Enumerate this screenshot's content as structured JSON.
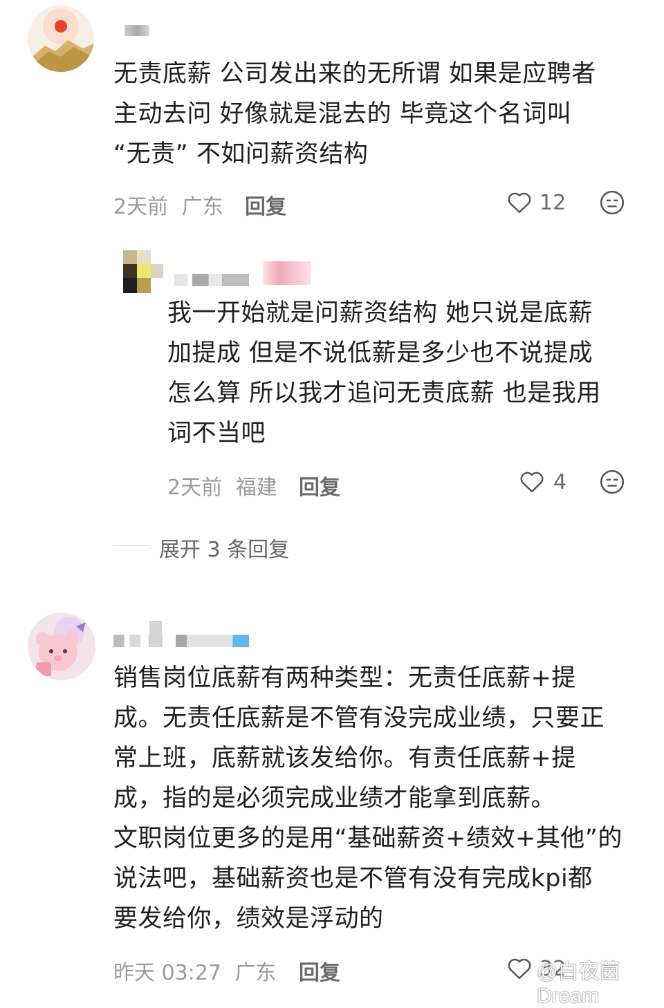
{
  "comments": [
    {
      "text": "无责底薪 公司发出来的无所谓 如果是应聘者\n主动去问 好像就是混去的 毕竟这个名词叫\n“无责” 不如问薪资结构",
      "time": "2天前",
      "location": "广东",
      "reply_label": "回复",
      "likes": "12",
      "avatar_icon": "sunset-mountain-avatar"
    },
    {
      "text": "我一开始就是问薪资结构 她只说是底薪\n加提成 但是不说低薪是多少也不说提成\n怎么算 所以我才追问无责底薪 也是我用\n词不当吧",
      "time": "2天前",
      "location": "福建",
      "reply_label": "回复",
      "likes": "4",
      "avatar_icon": "pixelated-avatar"
    },
    {
      "text": "销售岗位底薪有两种类型：无责任底薪+提\n成。无责任底薪是不管有没完成业绩，只要正\n常上班，底薪就该发给你。有责任底薪+提\n成，指的是必须完成业绩才能拿到底薪。\n文职岗位更多的是用“基础薪资+绩效+其他”的\n说法吧，基础薪资也是不管有没有完成kpi都\n要发给你，绩效是浮动的",
      "time": "昨天 03:27",
      "location": "广东",
      "reply_label": "回复",
      "likes": "32",
      "avatar_icon": "plush-bear-avatar"
    }
  ],
  "expand_replies": "展开 3 条回复",
  "watermark": "@白夜茵Dream",
  "colors": {
    "text": "#202020",
    "meta": "#9b9b9b",
    "icon": "#555555"
  }
}
